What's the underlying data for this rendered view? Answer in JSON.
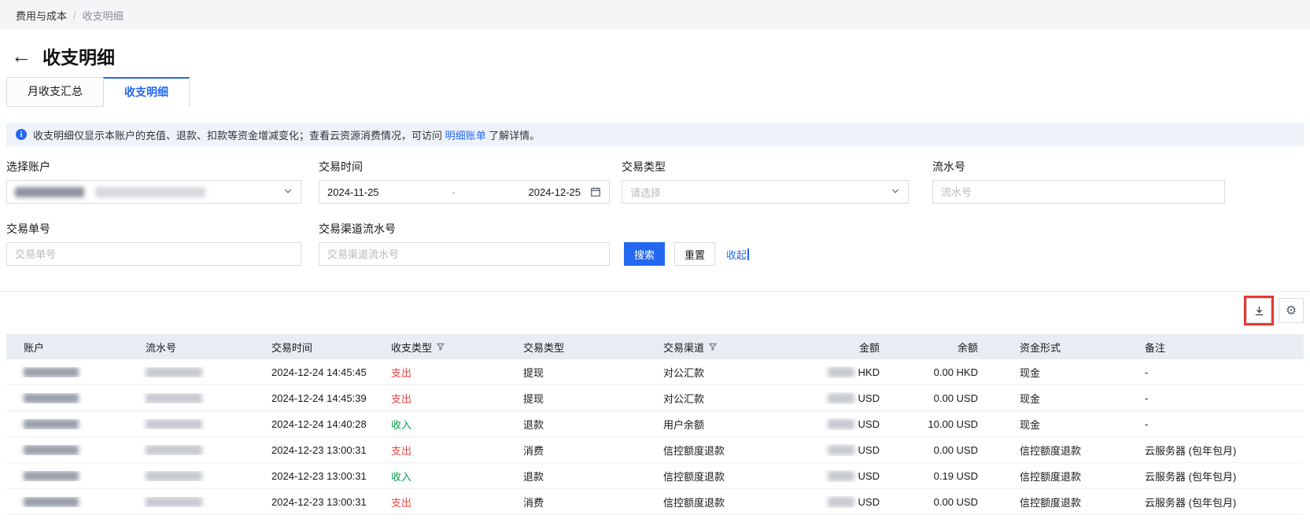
{
  "colors": {
    "accent": "#2468f2",
    "expense": "#e54545",
    "income": "#0a9e4e",
    "highlight": "#e8382d"
  },
  "breadcrumb": {
    "section": "费用与成本",
    "separator": "/",
    "current": "收支明细"
  },
  "page": {
    "back_icon": "←",
    "title": "收支明细"
  },
  "tabs": [
    {
      "label": "月收支汇总",
      "active": false
    },
    {
      "label": "收支明细",
      "active": true
    }
  ],
  "banner": {
    "text": "收支明细仅显示本账户的充值、退款、扣款等资金增减变化；查看云资源消费情况，可访问",
    "link_text": "明细账单",
    "text_after": "了解详情。"
  },
  "filters": {
    "account": {
      "label": "选择账户",
      "value_blurred": true
    },
    "date_range": {
      "label": "交易时间",
      "start": "2024-11-25",
      "separator": "-",
      "end": "2024-12-25"
    },
    "transaction_type": {
      "label": "交易类型",
      "placeholder": "请选择"
    },
    "serial_number": {
      "label": "流水号",
      "placeholder": "流水号"
    },
    "order_number": {
      "label": "交易单号",
      "placeholder": "交易单号"
    },
    "channel_serial": {
      "label": "交易渠道流水号",
      "placeholder": "交易渠道流水号"
    },
    "search_button": "搜索",
    "reset_button": "重置",
    "collapse_link": "收起"
  },
  "toolbar": {
    "download_icon": "download",
    "settings_icon": "gear",
    "download_highlighted": true
  },
  "table": {
    "columns": [
      {
        "label": "账户",
        "filter": false
      },
      {
        "label": "流水号",
        "filter": false
      },
      {
        "label": "交易时间",
        "filter": false
      },
      {
        "label": "收支类型",
        "filter": true
      },
      {
        "label": "交易类型",
        "filter": false
      },
      {
        "label": "交易渠道",
        "filter": true
      },
      {
        "label": "金额",
        "filter": false,
        "align": "right"
      },
      {
        "label": "余额",
        "filter": false,
        "align": "right"
      },
      {
        "label": "资金形式",
        "filter": false
      },
      {
        "label": "备注",
        "filter": false
      }
    ],
    "rows": [
      {
        "account_blurred": true,
        "serial_blurred": true,
        "time": "2024-12-24 14:45:45",
        "io_type": "支出",
        "tx_type": "提现",
        "channel": "对公汇款",
        "amount_blurred": true,
        "amount_currency": "HKD",
        "balance": "0.00 HKD",
        "fund_form": "现金",
        "remark": "-"
      },
      {
        "account_blurred": true,
        "serial_blurred": true,
        "time": "2024-12-24 14:45:39",
        "io_type": "支出",
        "tx_type": "提现",
        "channel": "对公汇款",
        "amount_blurred": true,
        "amount_currency": "USD",
        "balance": "0.00 USD",
        "fund_form": "现金",
        "remark": "-"
      },
      {
        "account_blurred": true,
        "serial_blurred": true,
        "time": "2024-12-24 14:40:28",
        "io_type": "收入",
        "tx_type": "退款",
        "channel": "用户余额",
        "amount_blurred": true,
        "amount_currency": "USD",
        "balance": "10.00 USD",
        "fund_form": "现金",
        "remark": "-"
      },
      {
        "account_blurred": true,
        "serial_blurred": true,
        "time": "2024-12-23 13:00:31",
        "io_type": "支出",
        "tx_type": "消费",
        "channel": "信控额度退款",
        "amount_blurred": true,
        "amount_currency": "USD",
        "balance": "0.00 USD",
        "fund_form": "信控额度退款",
        "remark": "云服务器 (包年包月)"
      },
      {
        "account_blurred": true,
        "serial_blurred": true,
        "time": "2024-12-23 13:00:31",
        "io_type": "收入",
        "tx_type": "退款",
        "channel": "信控额度退款",
        "amount_blurred": true,
        "amount_currency": "USD",
        "balance": "0.19 USD",
        "fund_form": "信控额度退款",
        "remark": "云服务器 (包年包月)"
      },
      {
        "account_blurred": true,
        "serial_blurred": true,
        "time": "2024-12-23 13:00:31",
        "io_type": "支出",
        "tx_type": "消费",
        "channel": "信控额度退款",
        "amount_blurred": true,
        "amount_currency": "USD",
        "balance": "0.00 USD",
        "fund_form": "信控额度退款",
        "remark": "云服务器 (包年包月)"
      }
    ]
  }
}
